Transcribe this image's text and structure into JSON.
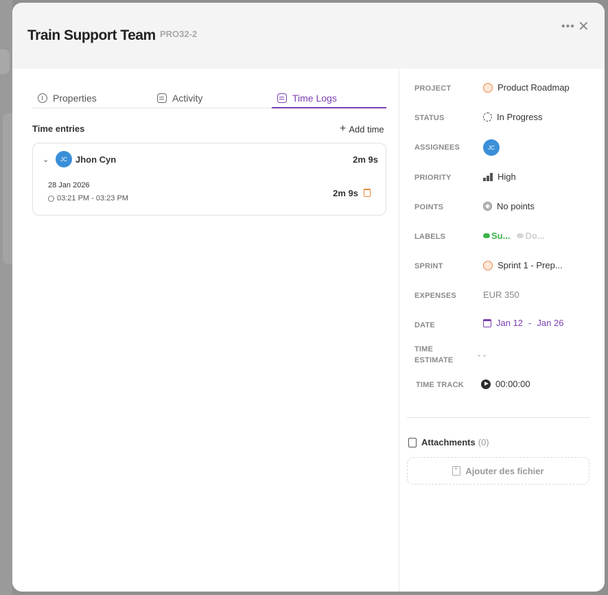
{
  "header": {
    "title": "Train Support Team",
    "code": "PRO32-2",
    "more_icon": "more-horizontal-icon",
    "close_icon": "close-icon"
  },
  "tabs": [
    {
      "label": "Properties",
      "icon": "info-icon"
    },
    {
      "label": "Activity",
      "icon": "list-icon"
    },
    {
      "label": "Time Logs",
      "icon": "list-icon",
      "active": true
    }
  ],
  "time_entries": {
    "section_label": "Time entries",
    "add_label": "Add time",
    "entries": [
      {
        "initials": "JC",
        "name": "Jhon Cyn",
        "total": "2m 9s",
        "date": "28 Jan 2026",
        "range": "03:21 PM - 03:23 PM",
        "duration": "2m 9s"
      }
    ]
  },
  "properties": {
    "project": {
      "label": "PROJECT",
      "value": "Product Roadmap"
    },
    "status": {
      "label": "STATUS",
      "value": "In Progress"
    },
    "assignees": {
      "label": "ASSIGNEES",
      "initials": "JC"
    },
    "priority": {
      "label": "PRIORITY",
      "value": "High"
    },
    "points": {
      "label": "POINTS",
      "value": "No points"
    },
    "labels": {
      "label": "LABELS",
      "items": [
        {
          "text": "Su...",
          "color": "#3cb34a"
        },
        {
          "text": "Do...",
          "color": "#cfcfcf"
        }
      ]
    },
    "sprint": {
      "label": "SPRINT",
      "value": "Sprint 1 - Prep..."
    },
    "expenses": {
      "label": "EXPENSES",
      "value": "EUR 350"
    },
    "date": {
      "label": "DATE",
      "start": "Jan 12",
      "separator": "-",
      "end": "Jan 26"
    },
    "time_estimate": {
      "label_line1": "TIME",
      "label_line2": "ESTIMATE",
      "value": "- -"
    },
    "time_track": {
      "label": "TIME TRACK",
      "value": "00:00:00"
    }
  },
  "attachments": {
    "label": "Attachments",
    "count": "(0)",
    "upload_label": "Ajouter des fichier"
  },
  "colors": {
    "accent": "#7a3fb0",
    "avatar": "#3a8fd8",
    "trash": "#e8883a"
  }
}
